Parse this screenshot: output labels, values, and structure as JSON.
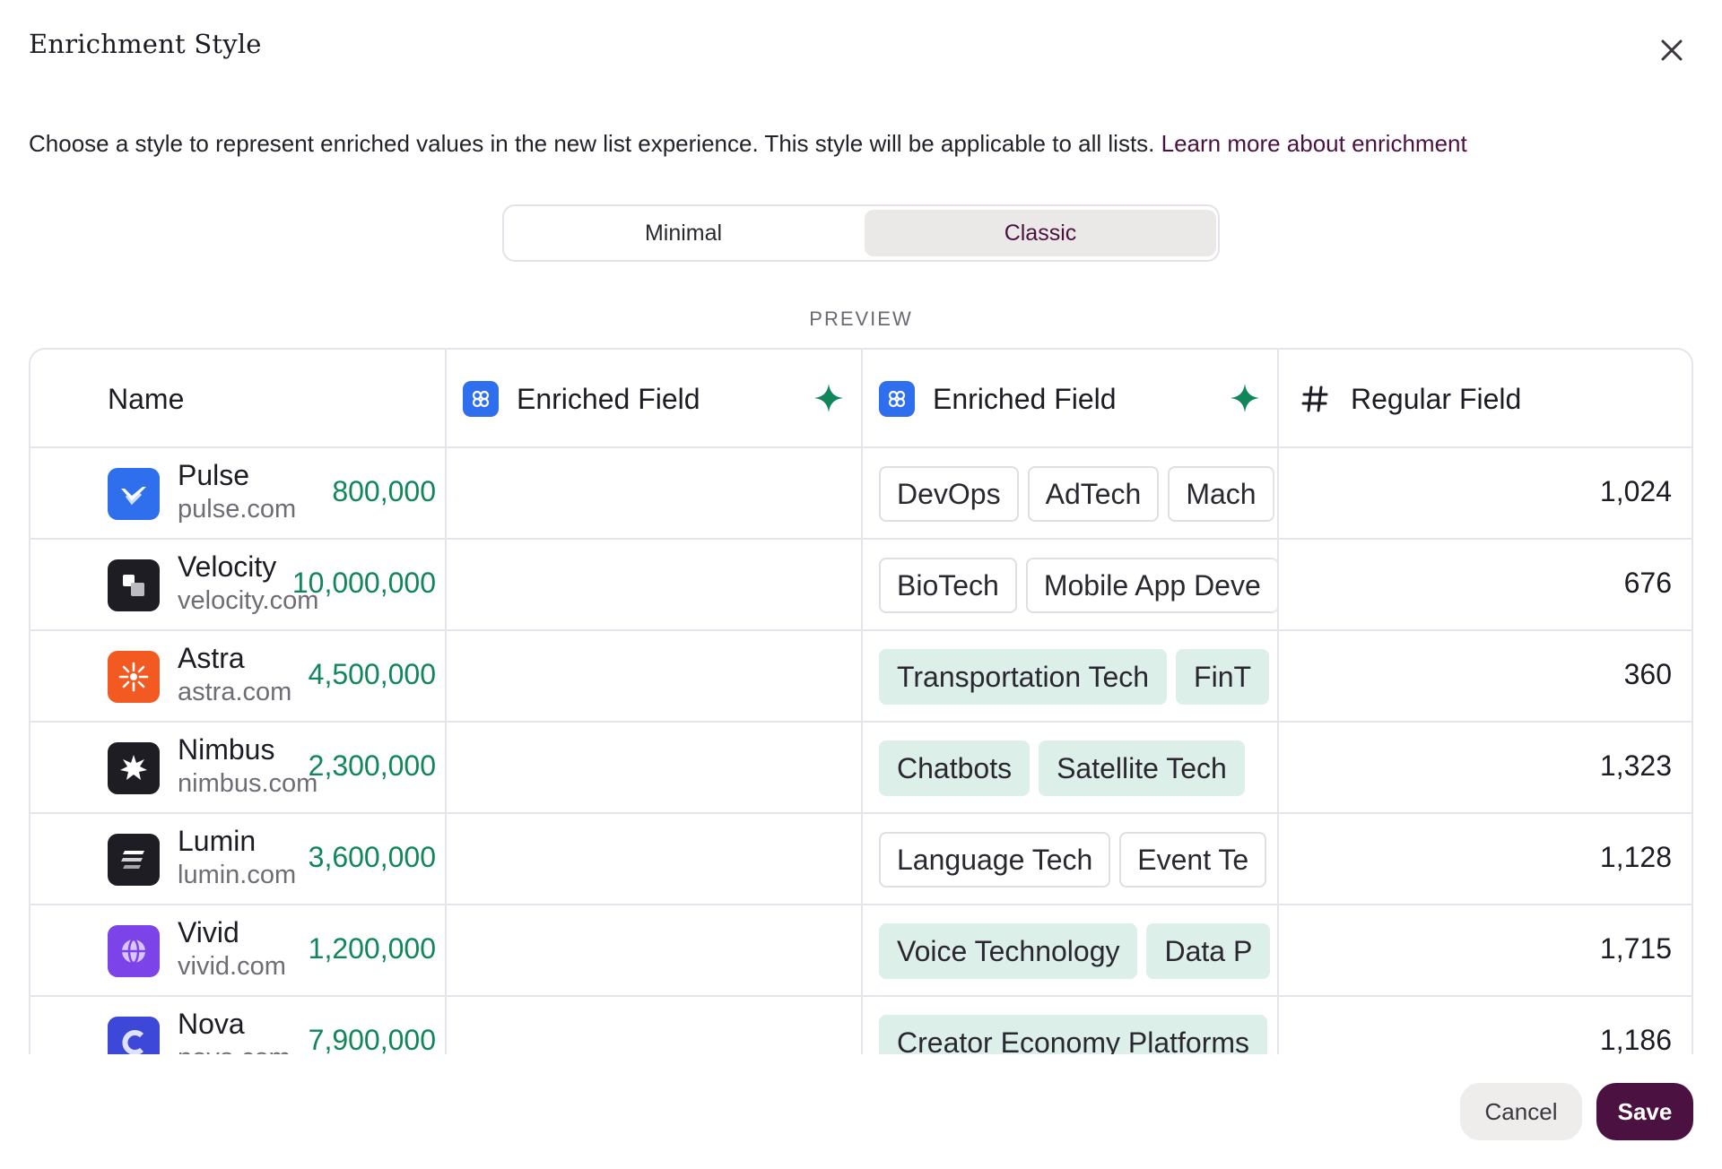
{
  "dialog": {
    "title": "Enrichment Style",
    "description": "Choose a style to represent enriched values in the new list experience. This style will be applicable to all lists.",
    "learn_more": "Learn more about enrichment"
  },
  "segmented": {
    "options": [
      "Minimal",
      "Classic"
    ],
    "selected": "Classic"
  },
  "preview_label": "PREVIEW",
  "table": {
    "columns": [
      "Name",
      "Enriched Field",
      "Enriched Field",
      "Regular Field"
    ],
    "rows": [
      {
        "name": "Pulse",
        "domain": "pulse.com",
        "value": "800,000",
        "tags": [
          "DevOps",
          "AdTech",
          "Mach"
        ],
        "tag_style": "outline",
        "regular": "1,024",
        "logo_color": "#2f6fed",
        "logo_icon": "check-wing-logo"
      },
      {
        "name": "Velocity",
        "domain": "velocity.com",
        "value": "10,000,000",
        "tags": [
          "BioTech",
          "Mobile App Deve"
        ],
        "tag_style": "outline",
        "regular": "676",
        "logo_color": "#1f1d24",
        "logo_icon": "blocks-logo"
      },
      {
        "name": "Astra",
        "domain": "astra.com",
        "value": "4,500,000",
        "tags": [
          "Transportation Tech",
          "FinT"
        ],
        "tag_style": "fill",
        "regular": "360",
        "logo_color": "#f25a22",
        "logo_icon": "sunburst-logo"
      },
      {
        "name": "Nimbus",
        "domain": "nimbus.com",
        "value": "2,300,000",
        "tags": [
          "Chatbots",
          "Satellite Tech"
        ],
        "tag_style": "fill",
        "regular": "1,323",
        "logo_color": "#1f1d24",
        "logo_icon": "star-burst-logo"
      },
      {
        "name": "Lumin",
        "domain": "lumin.com",
        "value": "3,600,000",
        "tags": [
          "Language Tech",
          "Event Te"
        ],
        "tag_style": "outline",
        "regular": "1,128",
        "logo_color": "#1f1d24",
        "logo_icon": "stripes-logo"
      },
      {
        "name": "Vivid",
        "domain": "vivid.com",
        "value": "1,200,000",
        "tags": [
          "Voice Technology",
          "Data P"
        ],
        "tag_style": "fill",
        "regular": "1,715",
        "logo_color": "#7b43e8",
        "logo_icon": "globe-logo"
      },
      {
        "name": "Nova",
        "domain": "nova.com",
        "value": "7,900,000",
        "tags": [
          "Creator Economy Platforms"
        ],
        "tag_style": "fill",
        "regular": "1,186",
        "logo_color": "#3d48d8",
        "logo_icon": "c-logo"
      }
    ]
  },
  "buttons": {
    "cancel": "Cancel",
    "save": "Save"
  },
  "colors": {
    "accent": "#4b1140",
    "enriched_value": "#11865a",
    "tag_fill": "#dcefe8",
    "enriched_icon": "#2f6fed"
  }
}
